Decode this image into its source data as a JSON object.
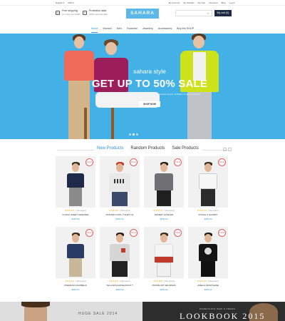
{
  "topbar": {
    "language": "English",
    "currency": "USD",
    "links": [
      "My Account",
      "My Wishlist",
      "My Cart",
      "Checkout",
      "Blog",
      "Log In"
    ]
  },
  "header": {
    "free_shipping_title": "Free shipping",
    "free_shipping_sub": "on order over $100",
    "protection_title": "Protection data",
    "protection_sub": "100% secured data",
    "logo": "SAHARA",
    "search_placeholder": "",
    "cart_label": "My cart (0)"
  },
  "nav": {
    "items": [
      "Home",
      "Women",
      "Men",
      "Footwear",
      "Jewellery",
      "Accessories",
      "Buy this SHOP"
    ],
    "active": "Home"
  },
  "hero": {
    "style_text": "sahara style",
    "headline": "GET UP TO 50% SALE",
    "subtext": "Lorem ipsum dolor sit amet, consectetur adipiscing elit, sed do eiusmod tempor incididunt ut labore et dolore",
    "button": "SHOP NOW",
    "colors": {
      "background": "#43b1e6"
    }
  },
  "tabs": {
    "items": [
      "New Products",
      "Random Products",
      "Sale Products"
    ],
    "active": "New Products",
    "prev_icon": "chevron-left-icon",
    "next_icon": "chevron-right-icon"
  },
  "products": [
    {
      "name": "CHOKO SHEET SWEATER",
      "price": "$250.00",
      "reviews": "1 Review(s)",
      "badge": "SALE"
    },
    {
      "name": "PRINTED COOL T-SHIRT 01",
      "price": "$250.00",
      "reviews": "1 Review(s)",
      "badge": "SALE"
    },
    {
      "name": "DONEET HOWLER",
      "price": "$250.00",
      "reviews": "1 Review(s)",
      "badge": "SALE"
    },
    {
      "name": "PUNCH & SAUNBY",
      "price": "$250.00",
      "reviews": "1 Review(s)",
      "badge": "SALE"
    },
    {
      "name": "PREMIUM CRUSBELS",
      "price": "$250.00",
      "reviews": "1 Review(s)",
      "badge": "SALE"
    },
    {
      "name": "YELLOWCOURSE PRINT T",
      "price": "$250.00",
      "reviews": "1 Review(s)",
      "badge": "SALE"
    },
    {
      "name": "PROMILOZT ZEURSUM",
      "price": "$250.00",
      "reviews": "1 Review(s)",
      "badge": "SALE"
    },
    {
      "name": "AMELIA PRINTSHINE",
      "price": "$250.00",
      "reviews": "1 Review(s)",
      "badge": "SALE"
    }
  ],
  "banners": {
    "left_title": "HUGE SALE 2014",
    "right_small": "SOMETHING NEW & FRESH",
    "right_big": "LOOKBOOK 2015"
  }
}
